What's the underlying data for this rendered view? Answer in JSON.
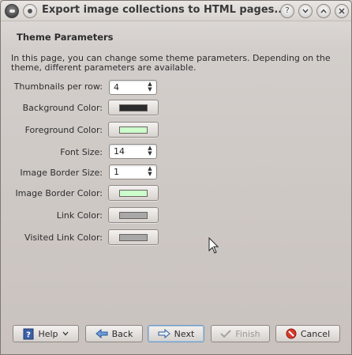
{
  "window": {
    "title": "Export image collections to HTML pages..."
  },
  "page": {
    "heading": "Theme Parameters",
    "description": "In this page, you can change some theme parameters. Depending on the theme, different parameters are available."
  },
  "params": {
    "thumbnails_per_row": {
      "label": "Thumbnails per row:",
      "value": "4"
    },
    "background_color": {
      "label": "Background Color:",
      "color": "#2b2b2b"
    },
    "foreground_color": {
      "label": "Foreground Color:",
      "color": "#ccffcc"
    },
    "font_size": {
      "label": "Font Size:",
      "value": "14"
    },
    "image_border_size": {
      "label": "Image Border Size:",
      "value": "1"
    },
    "image_border_color": {
      "label": "Image Border Color:",
      "color": "#ccffcc"
    },
    "link_color": {
      "label": "Link Color:",
      "color": "#a8a8a8"
    },
    "visited_link_color": {
      "label": "Visited Link Color:",
      "color": "#a8a8a8"
    }
  },
  "buttons": {
    "help": "Help",
    "back": "Back",
    "next": "Next",
    "finish": "Finish",
    "cancel": "Cancel"
  }
}
